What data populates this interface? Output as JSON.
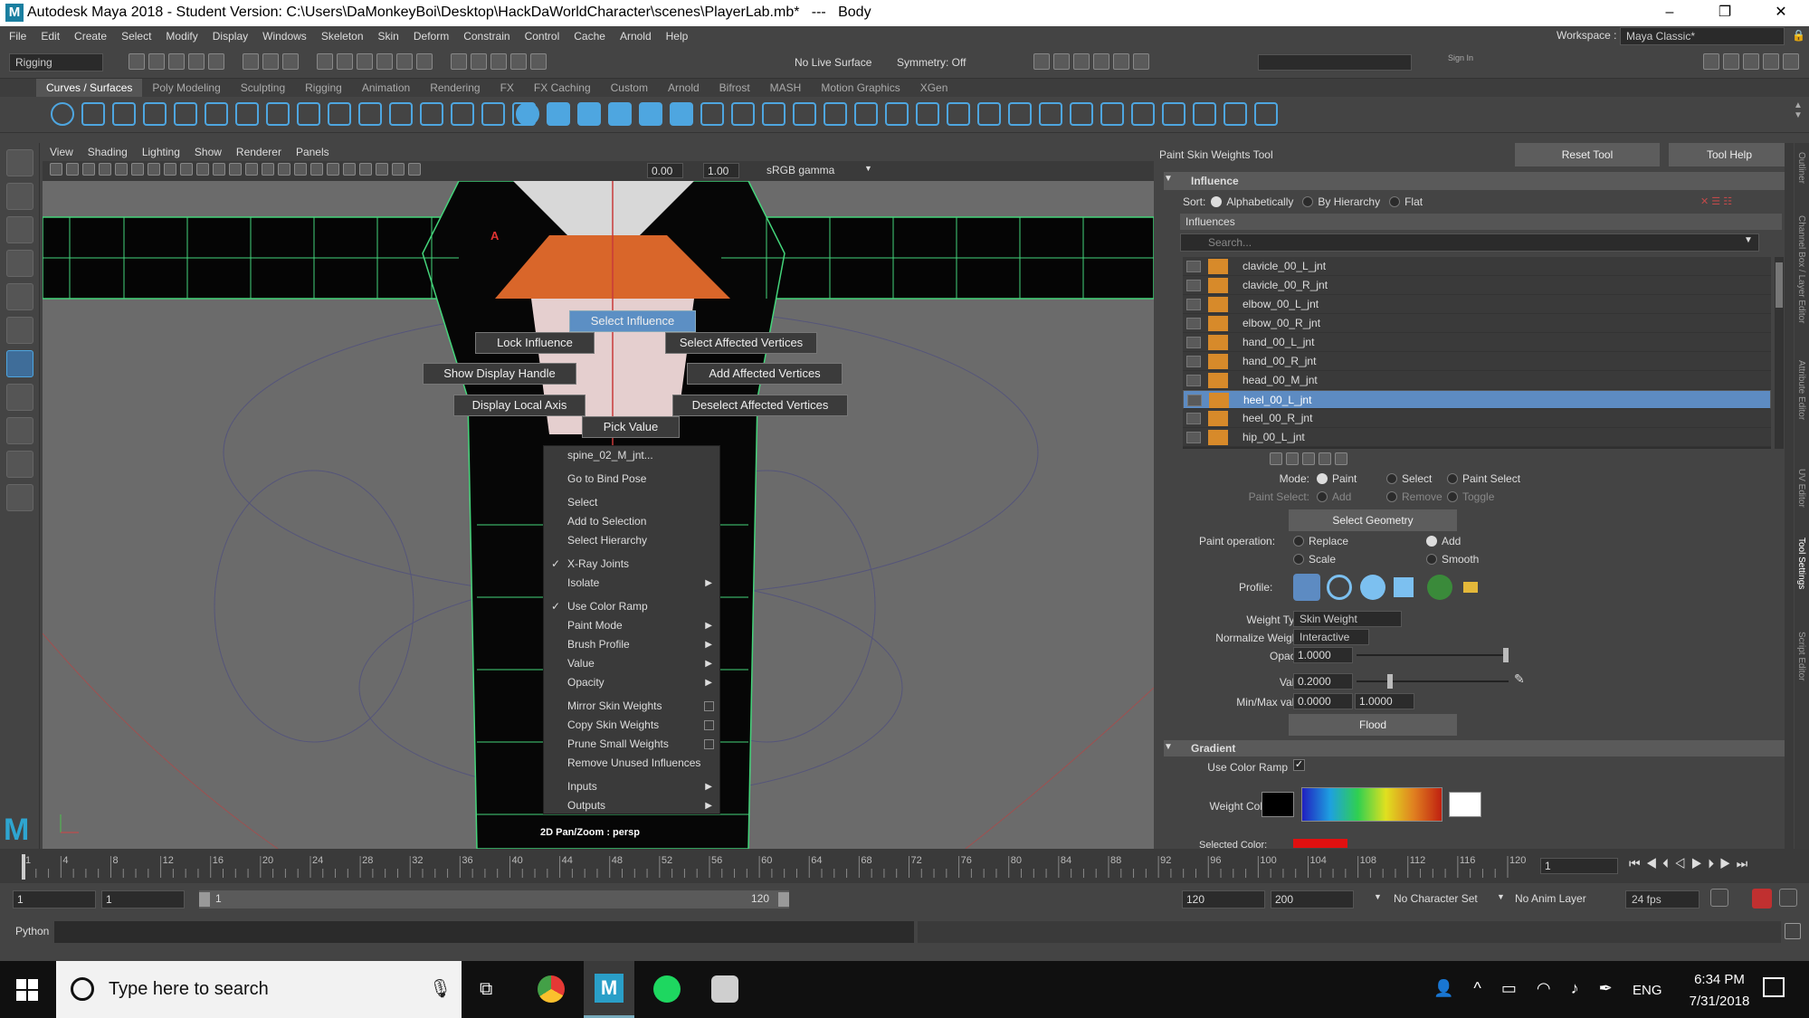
{
  "window": {
    "title": "Autodesk Maya 2018 - Student Version: C:\\Users\\DaMonkeyBoi\\Desktop\\HackDaWorldCharacter\\scenes\\PlayerLab.mb*   ---   Body",
    "logo": "M"
  },
  "menu": [
    "File",
    "Edit",
    "Create",
    "Select",
    "Modify",
    "Display",
    "Windows",
    "Skeleton",
    "Skin",
    "Deform",
    "Constrain",
    "Control",
    "Cache",
    "Arnold",
    "Help"
  ],
  "workspace": {
    "label": "Workspace :",
    "value": "Maya Classic*"
  },
  "status": {
    "menuset": "Rigging",
    "live_surface": "No Live Surface",
    "symmetry": "Symmetry: Off",
    "sign_in": "Sign In"
  },
  "shelf_tabs": [
    "Curves / Surfaces",
    "Poly Modeling",
    "Sculpting",
    "Rigging",
    "Animation",
    "Rendering",
    "FX",
    "FX Caching",
    "Custom",
    "Arnold",
    "Bifrost",
    "MASH",
    "Motion Graphics",
    "XGen"
  ],
  "viewport": {
    "menu": [
      "View",
      "Shading",
      "Lighting",
      "Show",
      "Renderer",
      "Panels"
    ],
    "exposure": "0.00",
    "gamma": "1.00",
    "color_space": "sRGB gamma",
    "hud": "2D Pan/Zoom : persp",
    "marker": "A"
  },
  "marking_menu": {
    "top": "Select Influence",
    "left1": "Lock Influence",
    "right1": "Select Affected Vertices",
    "left2": "Show Display Handle",
    "right2": "Add Affected Vertices",
    "left3": "Display Local Axis",
    "right3": "Deselect Affected Vertices",
    "bottom": "Pick Value"
  },
  "context_menu": [
    {
      "label": "spine_02_M_jnt..."
    },
    {
      "sep": true
    },
    {
      "label": "Go to Bind Pose"
    },
    {
      "sep": true
    },
    {
      "label": "Select"
    },
    {
      "label": "Add to Selection"
    },
    {
      "label": "Select Hierarchy"
    },
    {
      "sep": true
    },
    {
      "label": "X-Ray Joints",
      "check": true
    },
    {
      "label": "Isolate",
      "sub": true
    },
    {
      "sep": true
    },
    {
      "label": "Use Color Ramp",
      "check": true
    },
    {
      "label": "Paint Mode",
      "sub": true
    },
    {
      "label": "Brush Profile",
      "sub": true
    },
    {
      "label": "Value",
      "sub": true
    },
    {
      "label": "Opacity",
      "sub": true
    },
    {
      "sep": true
    },
    {
      "label": "Mirror Skin Weights",
      "box": true
    },
    {
      "label": "Copy Skin Weights",
      "box": true
    },
    {
      "label": "Prune Small Weights",
      "box": true
    },
    {
      "label": "Remove Unused Influences"
    },
    {
      "sep": true
    },
    {
      "label": "Inputs",
      "sub": true
    },
    {
      "label": "Outputs",
      "sub": true
    }
  ],
  "tool": {
    "title": "Paint Skin Weights Tool",
    "reset": "Reset Tool",
    "help": "Tool Help"
  },
  "influence": {
    "section": "Influence",
    "sort_label": "Sort:",
    "sort_alpha": "Alphabetically",
    "sort_hier": "By Hierarchy",
    "sort_flat": "Flat",
    "list_header": "Influences",
    "search_placeholder": "Search...",
    "items": [
      "clavicle_00_L_jnt",
      "clavicle_00_R_jnt",
      "elbow_00_L_jnt",
      "elbow_00_R_jnt",
      "hand_00_L_jnt",
      "hand_00_R_jnt",
      "head_00_M_jnt",
      "heel_00_L_jnt",
      "heel_00_R_jnt",
      "hip_00_L_jnt"
    ]
  },
  "mode": {
    "label": "Mode:",
    "paint": "Paint",
    "select": "Select",
    "paint_select": "Paint Select",
    "ps_label": "Paint Select:",
    "add": "Add",
    "remove": "Remove",
    "toggle": "Toggle",
    "select_geometry": "Select Geometry"
  },
  "paint_op": {
    "label": "Paint operation:",
    "replace": "Replace",
    "add": "Add",
    "scale": "Scale",
    "smooth": "Smooth"
  },
  "profile": {
    "label": "Profile:"
  },
  "weights": {
    "type_label": "Weight Type:",
    "type": "Skin Weight",
    "norm_label": "Normalize Weights:",
    "norm": "Interactive",
    "opacity_label": "Opacity:",
    "opacity": "1.0000",
    "value_label": "Value:",
    "value": "0.2000",
    "minmax_label": "Min/Max value:",
    "min": "0.0000",
    "max": "1.0000",
    "flood": "Flood"
  },
  "gradient": {
    "section": "Gradient",
    "use_ramp": "Use Color Ramp",
    "weight_color": "Weight Color:",
    "selected_color": "Selected Color:"
  },
  "side_tabs": [
    "Outliner",
    "Channel Box / Layer Editor",
    "Attribute Editor",
    "UV Editor",
    "Tool Settings",
    "Script Editor"
  ],
  "timeline": {
    "ticks": [
      "1",
      "4",
      "8",
      "12",
      "16",
      "20",
      "24",
      "28",
      "32",
      "36",
      "40",
      "44",
      "48",
      "52",
      "56",
      "60",
      "64",
      "68",
      "72",
      "76",
      "80",
      "84",
      "88",
      "92",
      "96",
      "100",
      "104",
      "108",
      "112",
      "116",
      "120"
    ],
    "current": "1"
  },
  "range": {
    "start": "1",
    "anim_start": "1",
    "slider_start": "1",
    "slider_end": "120",
    "end": "120",
    "anim_end": "200",
    "char_set": "No Character Set",
    "anim_layer": "No Anim Layer",
    "fps": "24 fps"
  },
  "command": {
    "lang": "Python"
  },
  "taskbar": {
    "search": "Type here to search",
    "lang": "ENG",
    "time": "6:34 PM",
    "date": "7/31/2018"
  }
}
